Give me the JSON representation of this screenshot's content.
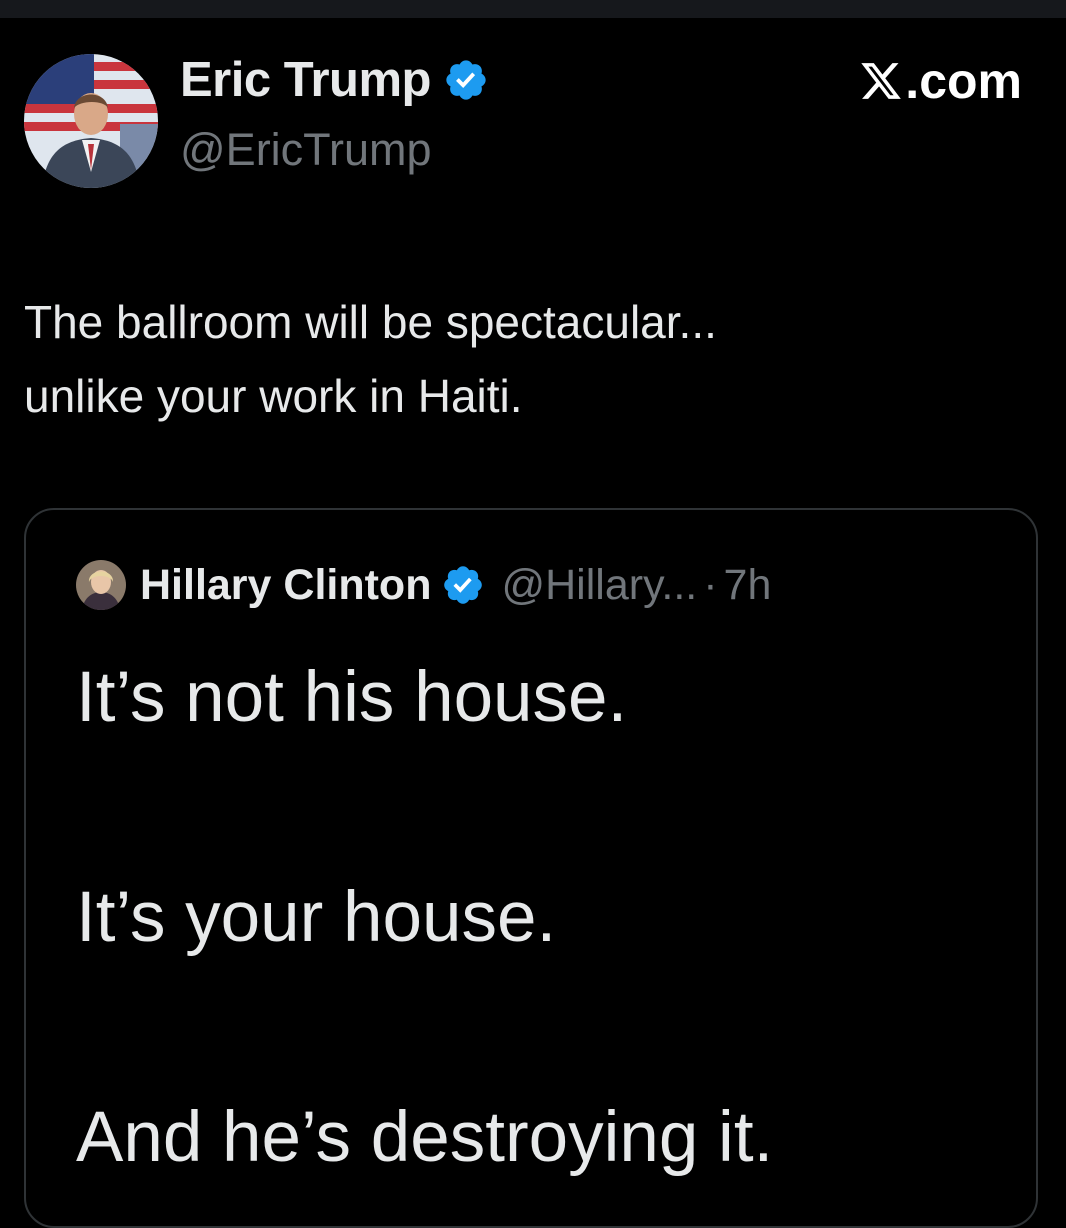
{
  "author": {
    "display_name": "Eric Trump",
    "handle": "@EricTrump",
    "verified": true
  },
  "brand": {
    "logo_icon": "x-logo-icon",
    "suffix": ".com"
  },
  "tweet": {
    "lines": [
      "The ballroom will be spectacular...",
      "unlike your work in Haiti."
    ]
  },
  "quoted_tweet": {
    "display_name": "Hillary Clinton",
    "verified": true,
    "handle": "@Hillary...",
    "separator": "·",
    "time": "7h",
    "lines": [
      "It’s not his house.",
      "It’s your house.",
      "And he’s destroying it."
    ]
  },
  "colors": {
    "background": "#000000",
    "text_primary": "#e7e9ea",
    "text_secondary": "#71767b",
    "verified_blue": "#1d9bf0",
    "card_border": "#2f3336"
  }
}
